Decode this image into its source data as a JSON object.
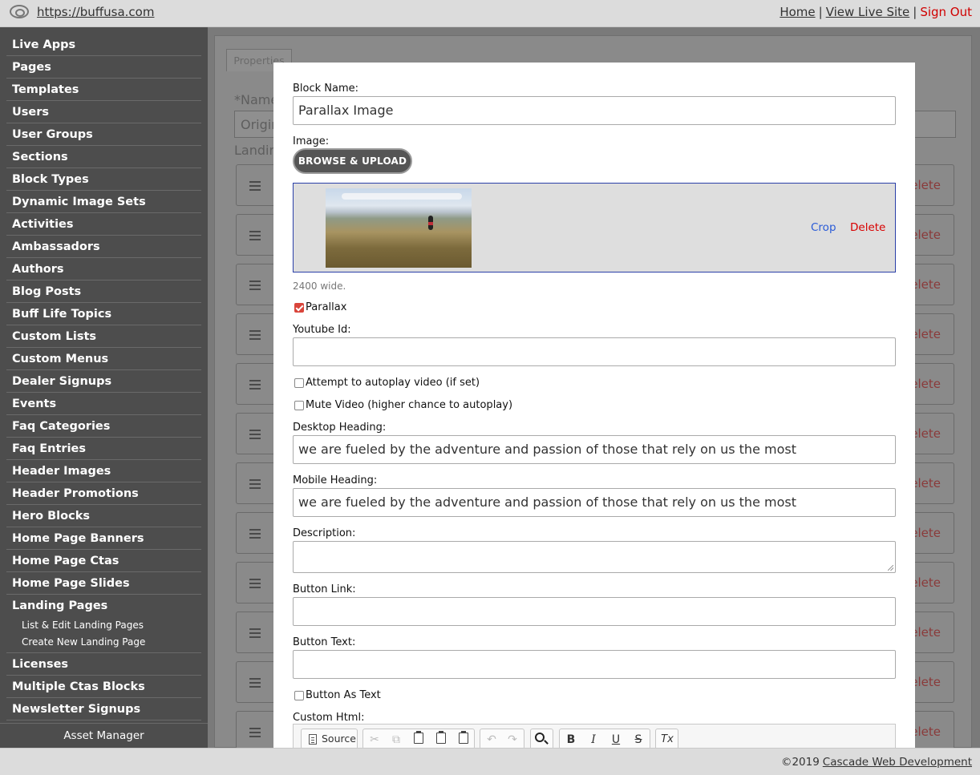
{
  "topbar": {
    "site_url": "https://buffusa.com",
    "home_link": "Home",
    "live_site_link": "View Live Site",
    "sign_out_link": "Sign Out",
    "separator": "|"
  },
  "sidebar": {
    "items": [
      {
        "label": "Live Apps"
      },
      {
        "label": "Pages"
      },
      {
        "label": "Templates"
      },
      {
        "label": "Users"
      },
      {
        "label": "User Groups"
      },
      {
        "label": "Sections"
      },
      {
        "label": "Block Types"
      },
      {
        "label": "Dynamic Image Sets"
      },
      {
        "label": "Activities"
      },
      {
        "label": "Ambassadors"
      },
      {
        "label": "Authors"
      },
      {
        "label": "Blog Posts"
      },
      {
        "label": "Buff Life Topics"
      },
      {
        "label": "Custom Lists"
      },
      {
        "label": "Custom Menus"
      },
      {
        "label": "Dealer Signups"
      },
      {
        "label": "Events"
      },
      {
        "label": "Faq Categories"
      },
      {
        "label": "Faq Entries"
      },
      {
        "label": "Header Images"
      },
      {
        "label": "Header Promotions"
      },
      {
        "label": "Hero Blocks"
      },
      {
        "label": "Home Page Banners"
      },
      {
        "label": "Home Page Ctas"
      },
      {
        "label": "Home Page Slides"
      },
      {
        "label": "Landing Pages"
      },
      {
        "label": "Licenses"
      },
      {
        "label": "Multiple Ctas Blocks"
      },
      {
        "label": "Newsletter Signups"
      }
    ],
    "landing_sub": {
      "list_edit": "List & Edit Landing Pages",
      "create_new": "Create New Landing Page"
    },
    "asset_manager": "Asset Manager"
  },
  "background": {
    "tab_properties": "Properties",
    "name_label": "*Name",
    "name_value_partial": "Origin",
    "landing_label_partial": "Landin",
    "row_delete_partial": "elete"
  },
  "modal": {
    "block_name_label": "Block Name:",
    "block_name_value": "Parallax Image",
    "image_label": "Image:",
    "browse_button": "BROWSE & UPLOAD",
    "crop_link": "Crop",
    "delete_link": "Delete",
    "image_hint": "2400 wide.",
    "parallax_label": "Parallax",
    "parallax_checked": true,
    "youtube_label": "Youtube Id:",
    "youtube_value": "",
    "autoplay_label": "Attempt to autoplay video (if set)",
    "mute_label": "Mute Video (higher chance to autoplay)",
    "desktop_heading_label": "Desktop Heading:",
    "desktop_heading_value": "we are fueled by the adventure and passion of those that rely on us the most",
    "mobile_heading_label": "Mobile Heading:",
    "mobile_heading_value": "we are fueled by the adventure and passion of those that rely on us the most",
    "description_label": "Description:",
    "button_link_label": "Button Link:",
    "button_text_label": "Button Text:",
    "button_as_text_label": "Button As Text",
    "custom_html_label": "Custom Html:",
    "editor": {
      "source_label": "Source",
      "bold": "B",
      "italic": "I",
      "underline": "U",
      "strike": "S",
      "clear_format": "Tx"
    }
  },
  "footer": {
    "copyright": "©2019",
    "company_link": "Cascade Web Development"
  },
  "colors": {
    "sidebar_bg": "#4d4d4d",
    "accent_red": "#d80000",
    "link_blue": "#2a5bd7",
    "checkbox_red": "#d9453b"
  }
}
